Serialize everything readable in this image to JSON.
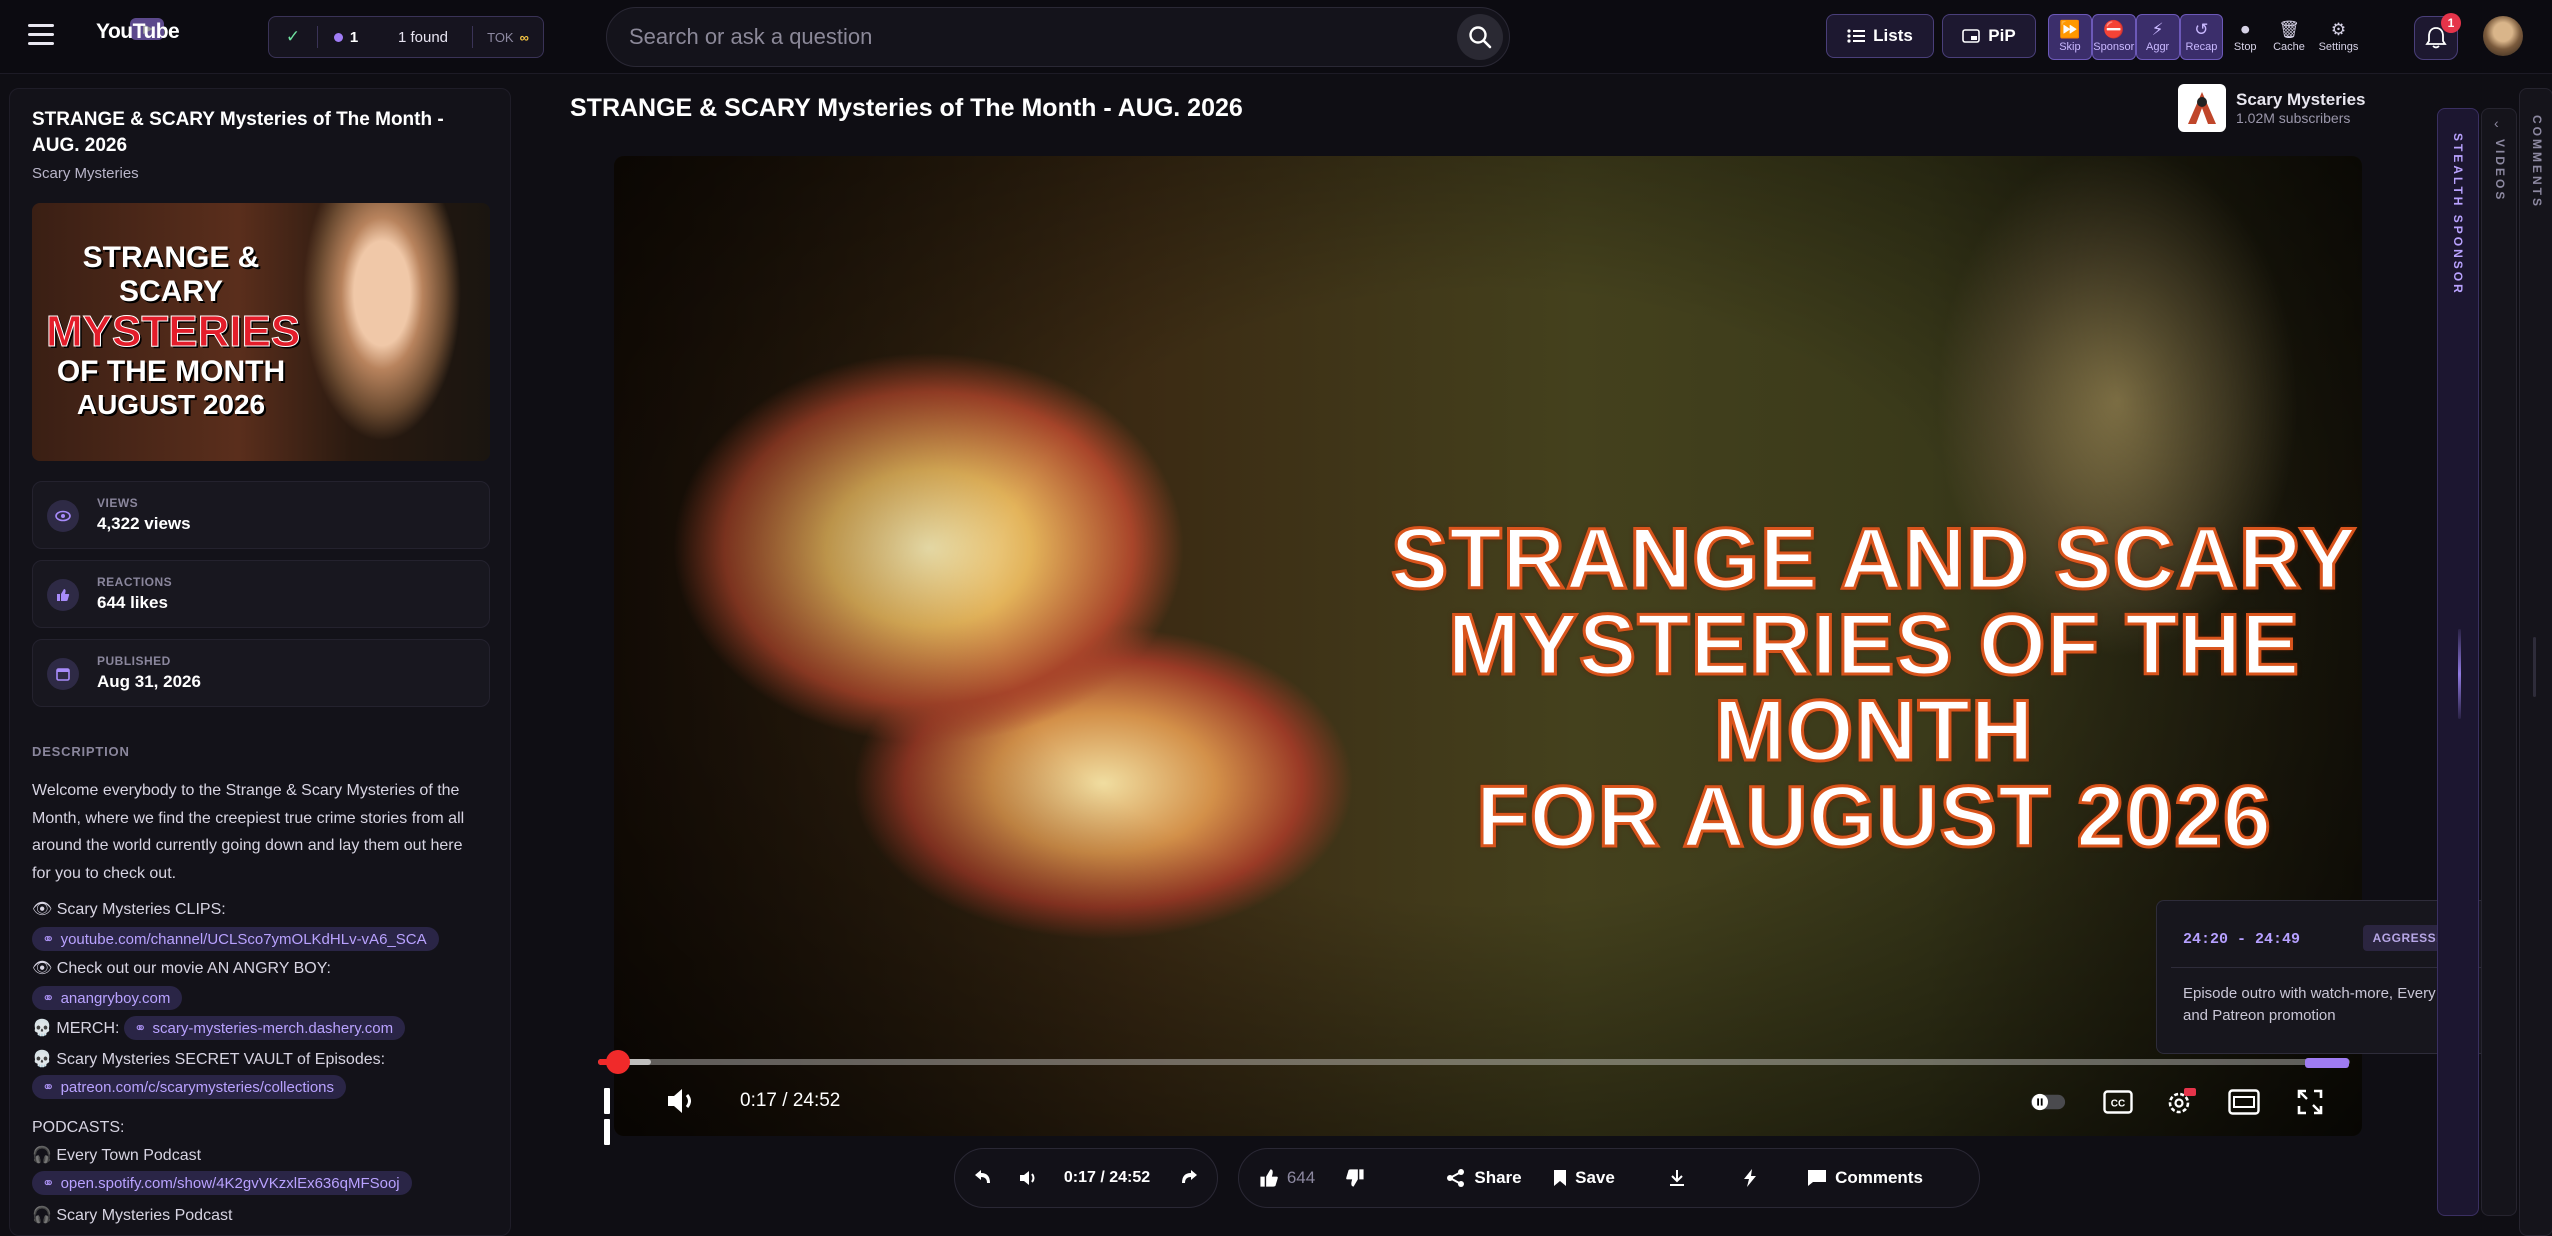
{
  "app": {
    "logo_text": "YouTube"
  },
  "status": {
    "count": "1",
    "found": "1 found",
    "tok_label": "TOK",
    "tok_value": "∞"
  },
  "search": {
    "placeholder": "Search or ask a question"
  },
  "toolbar": {
    "lists_label": "Lists",
    "pip_label": "PiP",
    "tools": [
      {
        "label": "Skip",
        "icon": "skip-icon"
      },
      {
        "label": "Sponsor",
        "icon": "sponsor-icon"
      },
      {
        "label": "Aggr",
        "icon": "lightning-icon"
      },
      {
        "label": "Recap",
        "icon": "recap-icon"
      },
      {
        "label": "Stop",
        "icon": "stop-icon"
      },
      {
        "label": "Cache",
        "icon": "trash-icon"
      },
      {
        "label": "Settings",
        "icon": "settings-icon"
      }
    ],
    "notification_count": "1"
  },
  "sidebar": {
    "title": "STRANGE & SCARY Mysteries of The Month - AUG. 2026",
    "channel": "Scary Mysteries",
    "thumbnail_text": {
      "line1": "STRANGE & SCARY",
      "line2": "MYSTERIES",
      "line3": "OF THE MONTH",
      "line4": "AUGUST 2026"
    },
    "stats": [
      {
        "label": "VIEWS",
        "value": "4,322 views",
        "icon": "eye-icon"
      },
      {
        "label": "REACTIONS",
        "value": "644 likes",
        "icon": "thumbs-up-icon"
      },
      {
        "label": "PUBLISHED",
        "value": "Aug 31, 2026",
        "icon": "calendar-icon"
      }
    ],
    "description_heading": "DESCRIPTION",
    "description": "Welcome everybody to the Strange & Scary Mysteries of the Month, where we find the creepiest true crime stories from all around the world currently going down and lay them out here for you to check out.",
    "lines": [
      {
        "prefix": "👁 Scary Mysteries CLIPS:",
        "link": ""
      },
      {
        "prefix": "",
        "link": "youtube.com/channel/UCLSco7ymOLKdHLv-vA6_SCA"
      },
      {
        "prefix": "👁 Check out our movie AN ANGRY BOY:",
        "link": ""
      },
      {
        "prefix": "",
        "link": "anangryboy.com"
      },
      {
        "prefix": "💀 MERCH:",
        "link": "scary-mysteries-merch.dashery.com"
      },
      {
        "prefix": "💀 Scary Mysteries SECRET VAULT of Episodes:",
        "link": ""
      },
      {
        "prefix": "",
        "link": "patreon.com/c/scarymysteries/collections"
      },
      {
        "prefix": "PODCASTS:",
        "link": ""
      },
      {
        "prefix": "🎧 Every Town Podcast",
        "link": ""
      },
      {
        "prefix": "",
        "link": "open.spotify.com/show/4K2gvVKzxlEx636qMFSooj"
      },
      {
        "prefix": "🎧 Scary Mysteries Podcast",
        "link": ""
      }
    ]
  },
  "video": {
    "title": "STRANGE & SCARY Mysteries of The Month - AUG. 2026",
    "channel_name": "Scary Mysteries",
    "subscribers": "1.02M subscribers",
    "overlay_line1": "STRANGE AND SCARY",
    "overlay_line2": "MYSTERIES OF THE MONTH",
    "overlay_line3": "FOR AUGUST 2026",
    "time": "0:17 / 24:52",
    "progress_fraction": 0.0114,
    "buffer_fraction": 0.03,
    "sponsor_segment": {
      "start_fraction": 0.9745,
      "end_fraction": 0.9993
    }
  },
  "sponsor_popup": {
    "range": "24:20 - 24:49",
    "tag": "AGGRESSIVE",
    "text": "Episode outro with watch-more, Every Town, and Patreon promotion"
  },
  "bottom_bar": {
    "time": "0:17 / 24:52",
    "likes": "644",
    "share_label": "Share",
    "save_label": "Save",
    "comments_label": "Comments"
  },
  "rails": {
    "stealth_sponsor": "STEALTH SPONSOR",
    "videos": "VIDEOS",
    "comments": "COMMENTS"
  },
  "colors": {
    "accent": "#9f7cf2",
    "progress": "#f02a2a",
    "background": "#0f0e14"
  }
}
